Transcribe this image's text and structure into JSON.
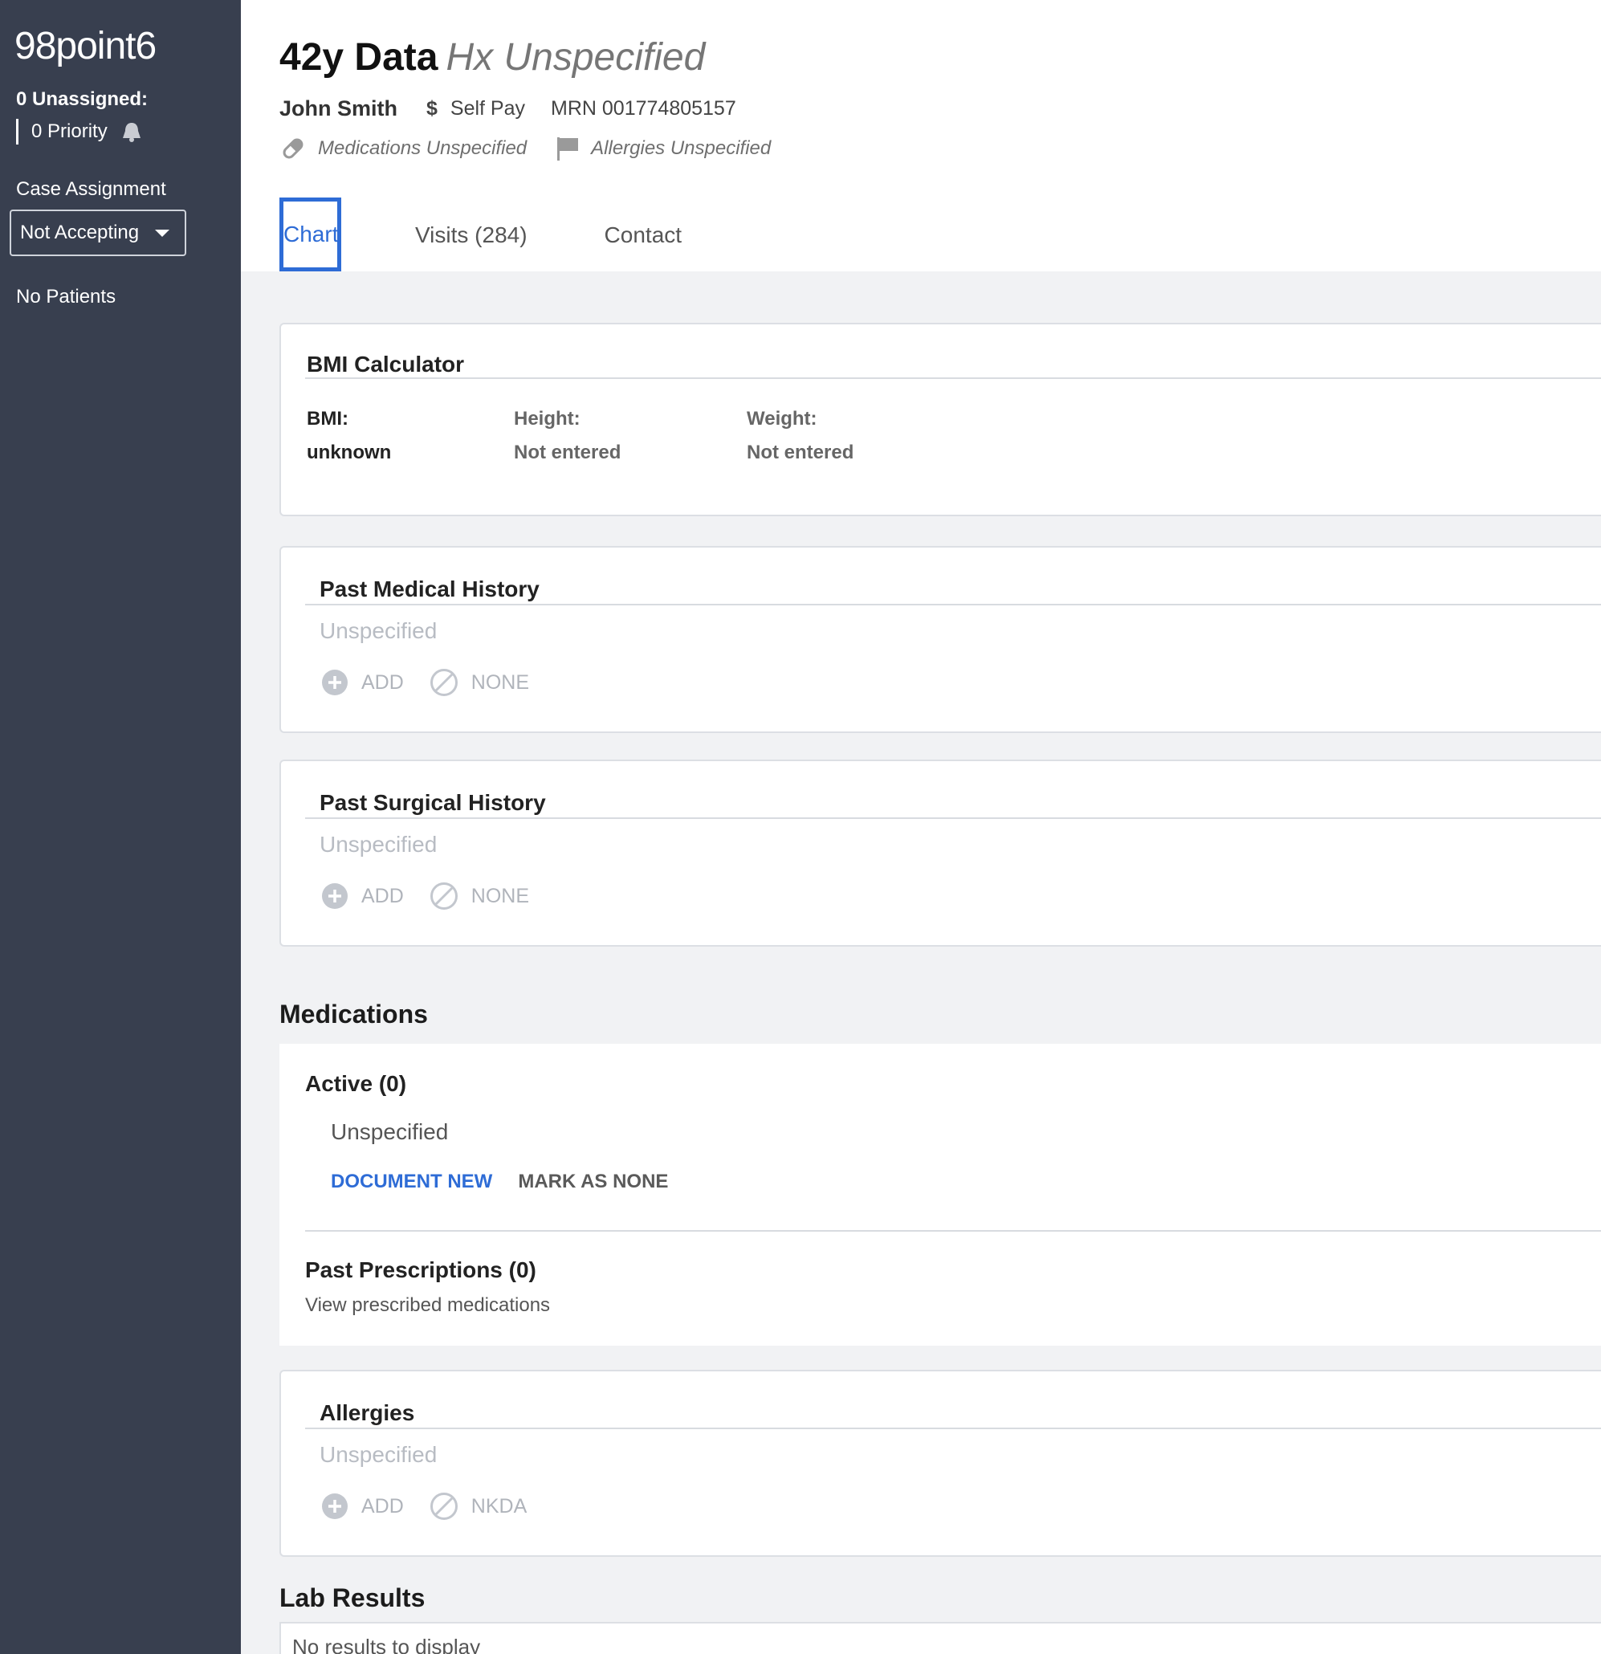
{
  "sidebar": {
    "logo": "98point6",
    "unassigned": "0 Unassigned:",
    "priority": "0 Priority",
    "case_assignment_label": "Case Assignment",
    "case_assignment_value": "Not Accepting",
    "no_patients": "No Patients"
  },
  "header": {
    "age_title": "42y Data",
    "hx": "Hx Unspecified",
    "patient_name": "John Smith",
    "payment": "Self Pay",
    "mrn": "MRN 001774805157",
    "medications_status": "Medications Unspecified",
    "allergies_status": "Allergies Unspecified"
  },
  "tabs": [
    {
      "label": "Chart",
      "active": true
    },
    {
      "label": "Visits (284)"
    },
    {
      "label": "Contact"
    }
  ],
  "bmi": {
    "title": "BMI Calculator",
    "bmi_label": "BMI:",
    "bmi_value": "unknown",
    "height_label": "Height:",
    "height_value": "Not entered",
    "weight_label": "Weight:",
    "weight_value": "Not entered"
  },
  "pmh": {
    "title": "Past Medical History",
    "value": "Unspecified",
    "add": "ADD",
    "none": "NONE"
  },
  "psh": {
    "title": "Past Surgical History",
    "value": "Unspecified",
    "add": "ADD",
    "none": "NONE"
  },
  "medications": {
    "heading": "Medications",
    "active_title": "Active (0)",
    "active_value": "Unspecified",
    "document_new": "DOCUMENT NEW",
    "mark_as_none": "MARK AS NONE",
    "past_title": "Past Prescriptions (0)",
    "past_link": "View prescribed medications"
  },
  "allergies": {
    "title": "Allergies",
    "value": "Unspecified",
    "add": "ADD",
    "nkda": "NKDA"
  },
  "lab": {
    "heading": "Lab Results",
    "empty": "No results to display"
  },
  "colors": {
    "sidebar_bg": "#383f4f",
    "accent_blue": "#2e6cd6",
    "page_bg": "#f1f2f4"
  }
}
